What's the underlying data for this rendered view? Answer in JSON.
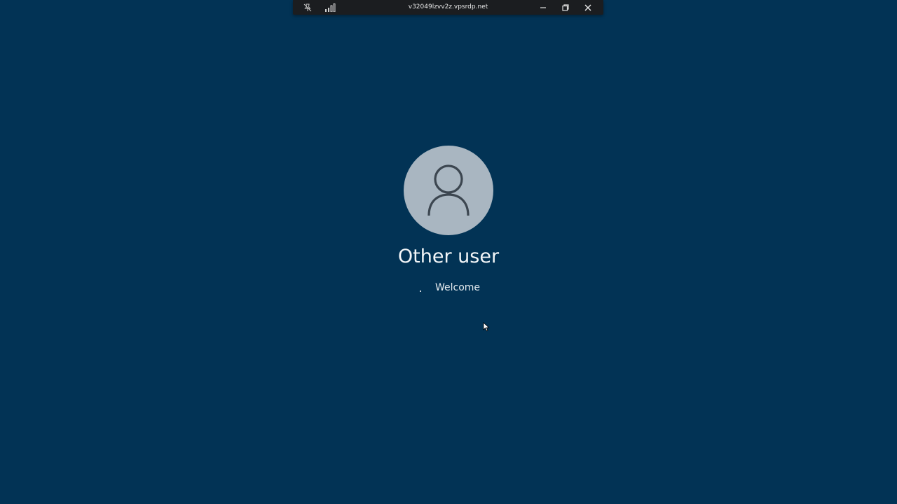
{
  "connection_bar": {
    "host": "v32049lzvv2z.vpsrdp.net",
    "icons": {
      "pin": "pin-off-icon",
      "signal": "signal-strength-icon",
      "minimize": "minimize-icon",
      "restore": "restore-icon",
      "close": "close-icon"
    }
  },
  "login": {
    "user_name": "Other user",
    "status": "Welcome",
    "avatar_icon": "user-avatar-icon"
  },
  "colors": {
    "background": "#023355",
    "avatar_bg": "#a9b6c1",
    "bar_bg": "#1b1d20"
  }
}
